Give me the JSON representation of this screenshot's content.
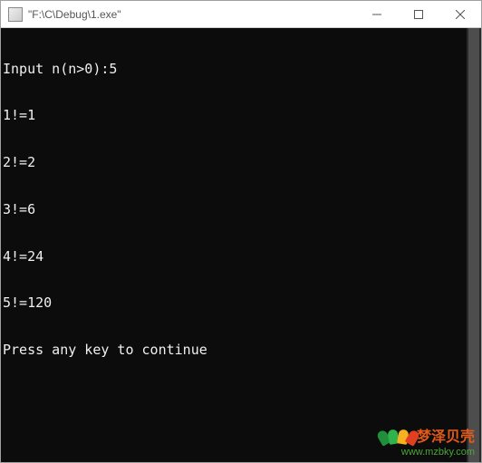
{
  "window": {
    "title": "\"F:\\C\\Debug\\1.exe\""
  },
  "console": {
    "prompt": "Input n(n>0):",
    "user_input": "5",
    "lines": [
      "1!=1",
      "2!=2",
      "3!=6",
      "4!=24",
      "5!=120",
      "Press any key to continue"
    ]
  },
  "watermark": {
    "brand": "梦泽贝壳",
    "url": "www.mzbky.com"
  }
}
